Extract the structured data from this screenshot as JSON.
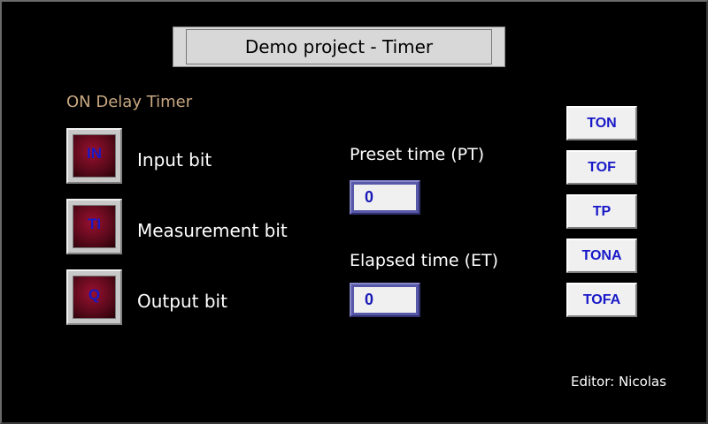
{
  "header": {
    "title": "Demo project - Timer"
  },
  "section": {
    "title": "ON Delay Timer"
  },
  "bits": [
    {
      "code": "IN",
      "label": "Input bit"
    },
    {
      "code": "TI",
      "label": "Measurement bit"
    },
    {
      "code": "Q",
      "label": "Output bit"
    }
  ],
  "params": {
    "preset_label": "Preset time (PT)",
    "preset_value": "0",
    "elapsed_label": "Elapsed time (ET)",
    "elapsed_value": "0"
  },
  "modes": [
    "TON",
    "TOF",
    "TP",
    "TONA",
    "TOFA"
  ],
  "footer": {
    "editor": "Editor: Nicolas"
  },
  "colors": {
    "background": "#000000",
    "section_title": "#c8a882",
    "bit_code": "#1818c8",
    "mode_text": "#1818c8"
  }
}
